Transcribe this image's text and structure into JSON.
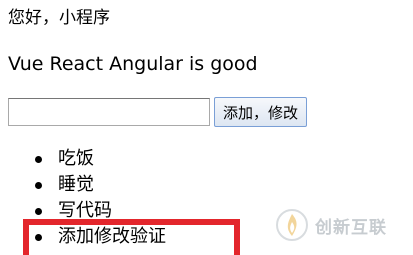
{
  "greeting": "您好，小程序",
  "subtitle": "Vue React Angular is good",
  "form": {
    "input_value": "",
    "input_placeholder": "",
    "submit_label": "添加，修改"
  },
  "todos": [
    {
      "label": "吃饭"
    },
    {
      "label": "睡觉"
    },
    {
      "label": "写代码"
    },
    {
      "label": "添加修改验证"
    }
  ],
  "watermark": {
    "icon": "flame-logo-icon",
    "text": "创新互联"
  },
  "colors": {
    "highlight_box": "#e3262c",
    "button_border": "#7a9fd6"
  }
}
